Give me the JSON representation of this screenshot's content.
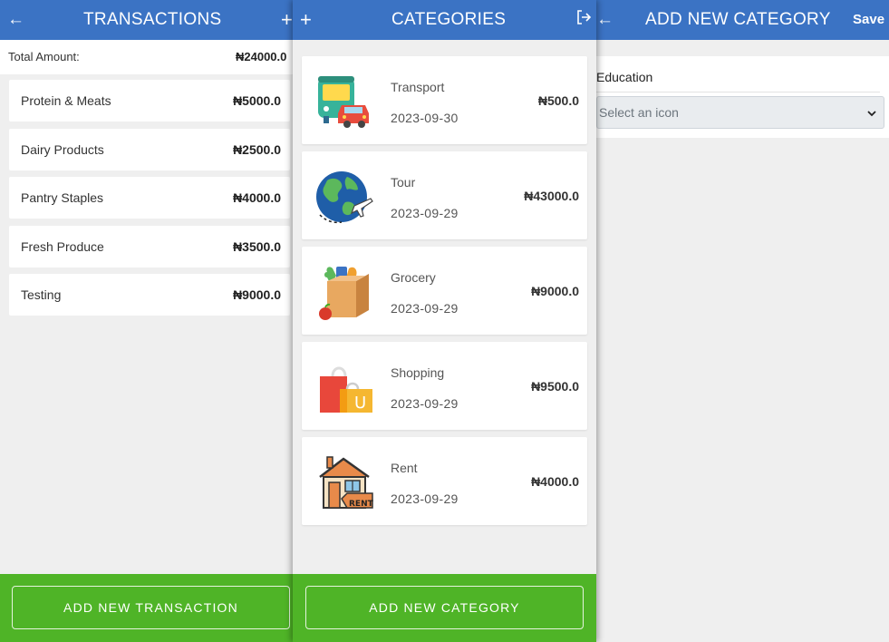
{
  "transactions": {
    "title": "TRANSACTIONS",
    "back_icon": "←",
    "add_icon": "+",
    "total_label": "Total Amount:",
    "total_value": "₦24000.0",
    "items": [
      {
        "name": "Protein & Meats",
        "amount": "₦5000.0"
      },
      {
        "name": "Dairy Products",
        "amount": "₦2500.0"
      },
      {
        "name": "Pantry Staples",
        "amount": "₦4000.0"
      },
      {
        "name": "Fresh Produce",
        "amount": "₦3500.0"
      },
      {
        "name": "Testing",
        "amount": "₦9000.0"
      }
    ],
    "add_button": "ADD NEW TRANSACTION"
  },
  "categories": {
    "title": "CATEGORIES",
    "add_icon": "+",
    "items": [
      {
        "name": "Transport",
        "date": "2023-09-30",
        "amount": "₦500.0",
        "icon": "bus-icon"
      },
      {
        "name": "Tour",
        "date": "2023-09-29",
        "amount": "₦43000.0",
        "icon": "globe-plane-icon"
      },
      {
        "name": "Grocery",
        "date": "2023-09-29",
        "amount": "₦9000.0",
        "icon": "grocery-bag-icon"
      },
      {
        "name": "Shopping",
        "date": "2023-09-29",
        "amount": "₦9500.0",
        "icon": "shopping-bags-icon"
      },
      {
        "name": "Rent",
        "date": "2023-09-29",
        "amount": "₦4000.0",
        "icon": "house-rent-icon"
      }
    ],
    "add_button": "ADD NEW CATEGORY"
  },
  "add_category": {
    "title": "ADD NEW CATEGORY",
    "back_icon": "←",
    "save_label": "Save",
    "name_value": "Education",
    "icon_placeholder": "Select an icon"
  },
  "colors": {
    "header": "#3b73c4",
    "footer": "#4fb427",
    "background": "#efefef"
  }
}
